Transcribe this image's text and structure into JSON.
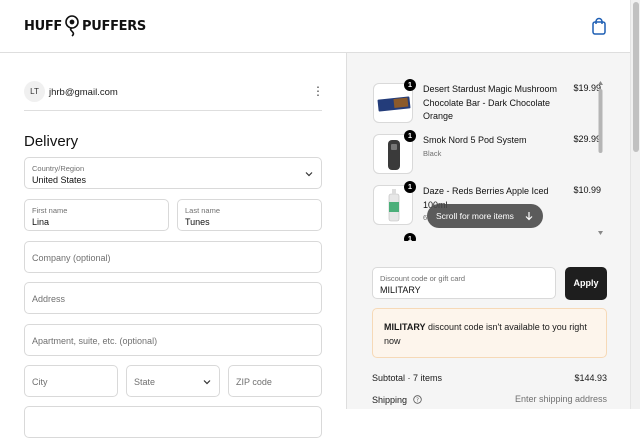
{
  "header": {
    "logo_part1": "HUFF",
    "logo_part2": "PUFFERS",
    "cart_icon": "shopping-bag-icon"
  },
  "account": {
    "initials": "LT",
    "email": "jhrb@gmail.com",
    "menu_icon": "kebab-menu-icon"
  },
  "delivery": {
    "title": "Delivery",
    "country": {
      "label": "Country/Region",
      "value": "United States"
    },
    "first_name": {
      "label": "First name",
      "value": "Lina"
    },
    "last_name": {
      "label": "Last name",
      "value": "Tunes"
    },
    "company": {
      "placeholder": "Company (optional)"
    },
    "address": {
      "placeholder": "Address"
    },
    "apartment": {
      "placeholder": "Apartment, suite, etc. (optional)"
    },
    "city": {
      "placeholder": "City"
    },
    "state": {
      "placeholder": "State"
    },
    "zip": {
      "placeholder": "ZIP code"
    }
  },
  "order": {
    "items": [
      {
        "qty": "1",
        "name": "Desert Stardust Magic Mushroom Chocolate Bar - Dark Chocolate Orange",
        "variant": "",
        "price": "$19.99"
      },
      {
        "qty": "1",
        "name": "Smok Nord 5 Pod System",
        "variant": "Black",
        "price": "$29.99"
      },
      {
        "qty": "1",
        "name": "Daze - Reds Berries Apple Iced 100ml",
        "variant": "6",
        "price": "$10.99"
      },
      {
        "qty": "1",
        "name": "",
        "variant": "",
        "price": ""
      }
    ],
    "scroll_hint": "Scroll for more items",
    "discount": {
      "label": "Discount code or gift card",
      "value": "MILITARY"
    },
    "apply_label": "Apply",
    "notice": {
      "code": "MILITARY",
      "message": " discount code isn't available to you right now"
    },
    "subtotal": {
      "label": "Subtotal · 7 items",
      "value": "$144.93"
    },
    "shipping": {
      "label": "Shipping",
      "value": "Enter shipping address"
    }
  },
  "colors": {
    "accent_dark": "#1e1e1e",
    "notice_bg": "#fdf5ec",
    "notice_border": "#f6d9b7",
    "summary_bg": "#f5f5f5"
  }
}
